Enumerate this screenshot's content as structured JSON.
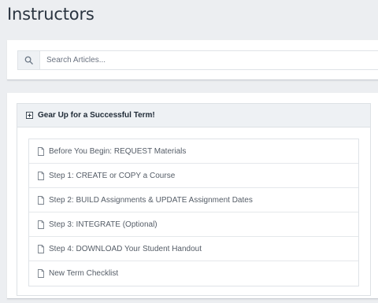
{
  "page": {
    "title": "Instructors"
  },
  "search": {
    "placeholder": "Search Articles..."
  },
  "section": {
    "title": "Gear Up for a Successful Term!",
    "articles": [
      {
        "label": "Before You Begin: REQUEST Materials"
      },
      {
        "label": "Step 1: CREATE or COPY a Course"
      },
      {
        "label": "Step 2: BUILD Assignments & UPDATE Assignment Dates"
      },
      {
        "label": "Step 3: INTEGRATE (Optional)"
      },
      {
        "label": "Step 4: DOWNLOAD Your Student Handout"
      },
      {
        "label": "New Term Checklist"
      }
    ]
  },
  "icons": {
    "search": "search-icon",
    "section_toggle": "plus-square-icon",
    "article": "document-icon"
  },
  "colors": {
    "background": "#eceef1",
    "panel": "#ffffff",
    "header_bg": "#eef1f4",
    "title_text": "#2a3440",
    "link_text": "#555d67"
  }
}
